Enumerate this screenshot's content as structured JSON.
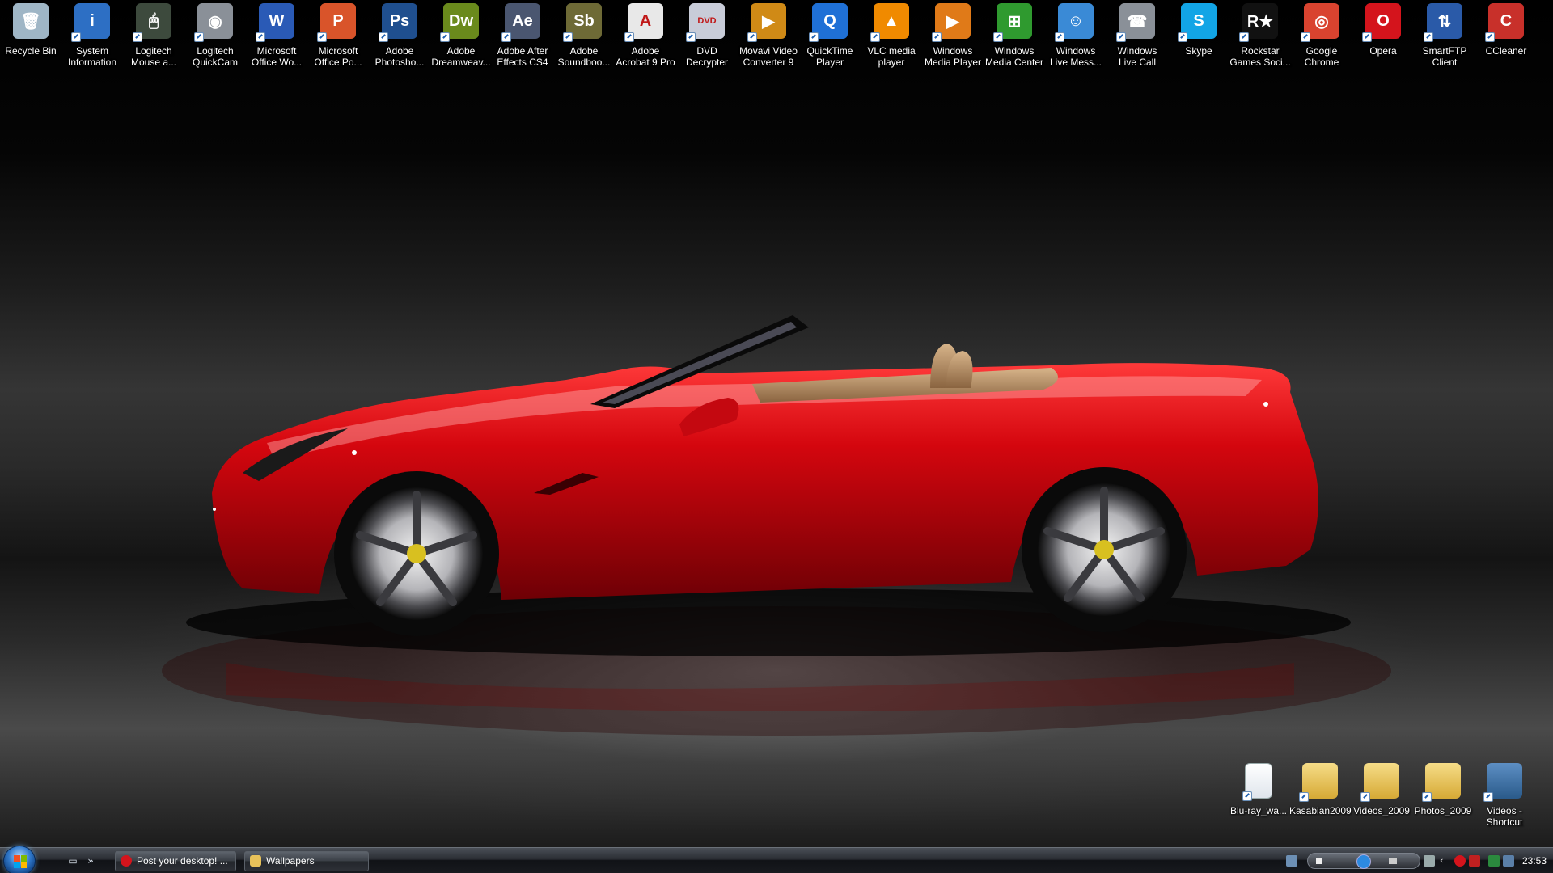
{
  "desktop": {
    "top_icons": [
      {
        "label": "Recycle Bin",
        "icon": "recycle-bin-icon",
        "color": "#9fb6c6",
        "glyph": "🗑",
        "shortcut": false
      },
      {
        "label": "System\nInformation",
        "icon": "system-information-icon",
        "color": "#2d6fc4",
        "glyph": "i",
        "shortcut": true
      },
      {
        "label": "Logitech\nMouse a...",
        "icon": "logitech-mouse-icon",
        "color": "#3d4a3d",
        "glyph": "🖱",
        "shortcut": true
      },
      {
        "label": "Logitech\nQuickCam",
        "icon": "webcam-icon",
        "color": "#8a9098",
        "glyph": "◉",
        "shortcut": true
      },
      {
        "label": "Microsoft\nOffice Wo...",
        "icon": "word-icon",
        "color": "#2a5ab6",
        "glyph": "W",
        "shortcut": true
      },
      {
        "label": "Microsoft\nOffice Po...",
        "icon": "powerpoint-icon",
        "color": "#d9542a",
        "glyph": "P",
        "shortcut": true
      },
      {
        "label": "Adobe\nPhotosho...",
        "icon": "photoshop-icon",
        "color": "#1f4f8f",
        "glyph": "Ps",
        "shortcut": true
      },
      {
        "label": "Adobe\nDreamweav...",
        "icon": "dreamweaver-icon",
        "color": "#6a8a1c",
        "glyph": "Dw",
        "shortcut": true
      },
      {
        "label": "Adobe After\nEffects CS4",
        "icon": "after-effects-icon",
        "color": "#4a5670",
        "glyph": "Ae",
        "shortcut": true
      },
      {
        "label": "Adobe\nSoundboo...",
        "icon": "soundbooth-icon",
        "color": "#6e6a36",
        "glyph": "Sb",
        "shortcut": true
      },
      {
        "label": "Adobe\nAcrobat 9 Pro",
        "icon": "acrobat-icon",
        "color": "#e8e8e8",
        "glyph": "A",
        "shortcut": true
      },
      {
        "label": "DVD\nDecrypter",
        "icon": "dvd-icon",
        "color": "#c8ccd8",
        "glyph": "DVD",
        "shortcut": true
      },
      {
        "label": "Movavi Video\nConverter 9",
        "icon": "movavi-icon",
        "color": "#d08a16",
        "glyph": "▶",
        "shortcut": true
      },
      {
        "label": "QuickTime\nPlayer",
        "icon": "quicktime-icon",
        "color": "#1f70d6",
        "glyph": "Q",
        "shortcut": true
      },
      {
        "label": "VLC media\nplayer",
        "icon": "vlc-icon",
        "color": "#f08a00",
        "glyph": "▲",
        "shortcut": true
      },
      {
        "label": "Windows\nMedia Player",
        "icon": "media-player-icon",
        "color": "#e07a18",
        "glyph": "▶",
        "shortcut": true
      },
      {
        "label": "Windows\nMedia Center",
        "icon": "media-center-icon",
        "color": "#2f9a2f",
        "glyph": "⊞",
        "shortcut": true
      },
      {
        "label": "Windows\nLive Mess...",
        "icon": "messenger-icon",
        "color": "#3a8ad6",
        "glyph": "☺",
        "shortcut": true
      },
      {
        "label": "Windows\nLive Call",
        "icon": "live-call-icon",
        "color": "#8a9098",
        "glyph": "☎",
        "shortcut": true
      },
      {
        "label": "Skype",
        "icon": "skype-icon",
        "color": "#12a5e6",
        "glyph": "S",
        "shortcut": true
      },
      {
        "label": "Rockstar\nGames Soci...",
        "icon": "rockstar-icon",
        "color": "#111111",
        "glyph": "R★",
        "shortcut": true
      },
      {
        "label": "Google\nChrome",
        "icon": "chrome-icon",
        "color": "#d9432f",
        "glyph": "◎",
        "shortcut": true
      },
      {
        "label": "Opera",
        "icon": "opera-icon",
        "color": "#d4141c",
        "glyph": "O",
        "shortcut": true
      },
      {
        "label": "SmartFTP\nClient",
        "icon": "smartftp-icon",
        "color": "#2a5aa8",
        "glyph": "⇅",
        "shortcut": true
      },
      {
        "label": "CCleaner",
        "icon": "ccleaner-icon",
        "color": "#c8302a",
        "glyph": "C",
        "shortcut": true
      }
    ],
    "bottom_icons": [
      {
        "label": "Blu-ray_wa...",
        "icon": "text-document-icon",
        "type": "doc"
      },
      {
        "label": "Kasabian2009",
        "icon": "folder-icon",
        "type": "folder"
      },
      {
        "label": "Videos_2009",
        "icon": "folder-icon",
        "type": "folder"
      },
      {
        "label": "Photos_2009",
        "icon": "folder-icon",
        "type": "folder"
      },
      {
        "label": "Videos -\nShortcut",
        "icon": "video-library-icon",
        "type": "library"
      }
    ]
  },
  "taskbar": {
    "quick_launch_more": "»",
    "buttons": [
      {
        "label": "Post your desktop! ...",
        "icon": "opera-icon",
        "color": "#d4141c"
      },
      {
        "label": "Wallpapers",
        "icon": "folder-icon",
        "color": "#e8c25a"
      }
    ],
    "clock": "23:53"
  }
}
